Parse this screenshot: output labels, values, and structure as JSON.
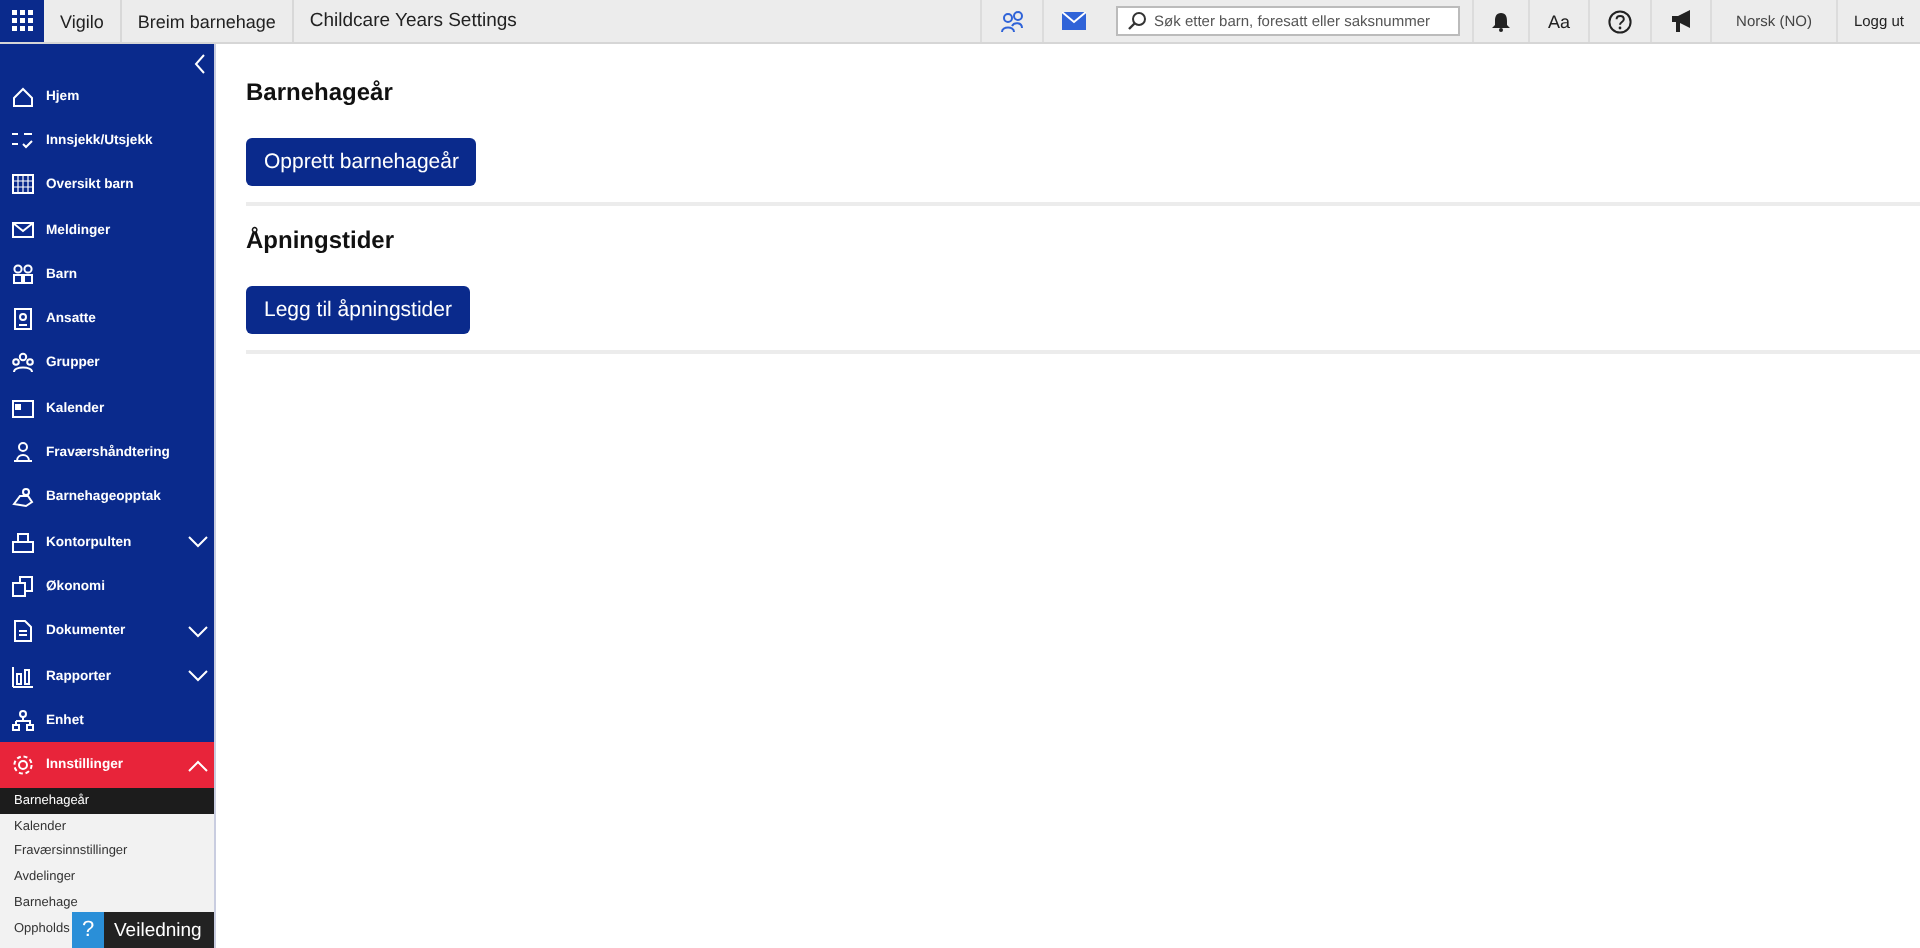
{
  "topbar": {
    "breadcrumbs": [
      "Vigilo",
      "Breim barnehage",
      "Childcare Years Settings"
    ],
    "search": {
      "placeholder": "Søk etter barn, foresatt eller saksnummer"
    },
    "font_button": "Aa",
    "language": "Norsk (NO)",
    "logout": "Logg ut"
  },
  "sidebar": {
    "items": [
      {
        "label": "Hjem",
        "kind": "link",
        "selected": false
      },
      {
        "label": "Innsjekk/Utsjekk",
        "kind": "link",
        "selected": false
      },
      {
        "label": "Oversikt barn",
        "kind": "link",
        "selected": false
      },
      {
        "label": "Meldinger",
        "kind": "link",
        "selected": false
      },
      {
        "label": "Barn",
        "kind": "link",
        "selected": false
      },
      {
        "label": "Ansatte",
        "kind": "link",
        "selected": false
      },
      {
        "label": "Grupper",
        "kind": "link",
        "selected": false
      },
      {
        "label": "Kalender",
        "kind": "link",
        "selected": false
      },
      {
        "label": "Fraværshåndtering",
        "kind": "link",
        "selected": false
      },
      {
        "label": "Barnehageopptak",
        "kind": "link",
        "selected": false
      },
      {
        "label": "Kontorpulten",
        "kind": "group",
        "selected": false,
        "expanded": false
      },
      {
        "label": "Økonomi",
        "kind": "link",
        "selected": false
      },
      {
        "label": "Dokumenter",
        "kind": "group",
        "selected": false,
        "expanded": false
      },
      {
        "label": "Rapporter",
        "kind": "group",
        "selected": false,
        "expanded": false
      },
      {
        "label": "Enhet",
        "kind": "link",
        "selected": false
      },
      {
        "label": "Innstillinger",
        "kind": "group",
        "selected": true,
        "expanded": true
      }
    ],
    "subitems": [
      {
        "label": "Barnehageår",
        "selected": true
      },
      {
        "label": "Kalender",
        "selected": false
      },
      {
        "label": "Fraværsinnstillinger",
        "selected": false
      },
      {
        "label": "Avdelinger",
        "selected": false
      },
      {
        "label": "Barnehage",
        "selected": false
      },
      {
        "label": "Oppholds",
        "selected": false
      }
    ]
  },
  "help_button": {
    "icon": "?",
    "label": "Veiledning"
  },
  "sections": [
    {
      "title": "Barnehageår",
      "button": "Opprett barnehageår"
    },
    {
      "title": "Åpningstider",
      "button": "Legg til åpningstider"
    }
  ]
}
